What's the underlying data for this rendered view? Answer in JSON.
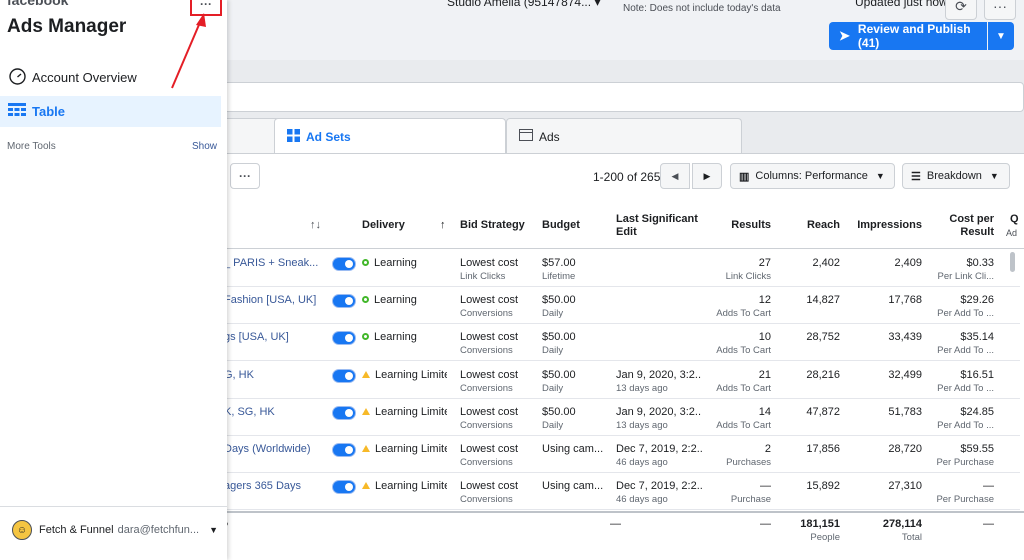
{
  "topbar": {
    "account_label": "Studio Amelia (95147874...",
    "date_note_top": "...",
    "date_note": "Note: Does not include today's data",
    "updated": "Updated just now",
    "refresh_icon": "refresh-icon",
    "more_icon": "more-icon",
    "review_publish": "Review and Publish (41)"
  },
  "tabs": {
    "adsets": "Ad Sets",
    "ads": "Ads"
  },
  "toolbar": {
    "more": "···",
    "pager": "1-200 of 265",
    "columns": "Columns: Performance",
    "breakdown": "Breakdown"
  },
  "table": {
    "headers": {
      "sort": "↑↓",
      "delivery": "Delivery",
      "delivery_arrow": "↑",
      "bid_strategy": "Bid Strategy",
      "budget": "Budget",
      "last_edit": "Last Significant Edit",
      "results": "Results",
      "reach": "Reach",
      "impressions": "Impressions",
      "cost_per_result": "Cost per Result",
      "q": "Q",
      "q_sub": "Ad"
    },
    "rows": [
      {
        "name": "_ PARIS + Sneak...",
        "delivery": "Learning",
        "status": "green",
        "bid": "Lowest cost",
        "bid_sub": "Link Clicks",
        "budget": "$57.00",
        "budget_sub": "Lifetime",
        "edit": "",
        "edit_sub": "",
        "results": "27",
        "results_sub": "Link Clicks",
        "reach": "2,402",
        "impressions": "2,409",
        "cpr": "$0.33",
        "cpr_sub": "Per Link Cli..."
      },
      {
        "name": "Fashion [USA, UK]",
        "delivery": "Learning",
        "status": "green",
        "bid": "Lowest cost",
        "bid_sub": "Conversions",
        "budget": "$50.00",
        "budget_sub": "Daily",
        "edit": "",
        "edit_sub": "",
        "results": "12",
        "results_sub": "Adds To Cart",
        "reach": "14,827",
        "impressions": "17,768",
        "cpr": "$29.26",
        "cpr_sub": "Per Add To ..."
      },
      {
        "name": "gs [USA, UK]",
        "delivery": "Learning",
        "status": "green",
        "bid": "Lowest cost",
        "bid_sub": "Conversions",
        "budget": "$50.00",
        "budget_sub": "Daily",
        "edit": "",
        "edit_sub": "",
        "results": "10",
        "results_sub": "Adds To Cart",
        "reach": "28,752",
        "impressions": "33,439",
        "cpr": "$35.14",
        "cpr_sub": "Per Add To ..."
      },
      {
        "name": "G, HK",
        "delivery": "Learning Limite",
        "status": "yellow",
        "bid": "Lowest cost",
        "bid_sub": "Conversions",
        "budget": "$50.00",
        "budget_sub": "Daily",
        "edit": "Jan 9, 2020, 3:2...",
        "edit_sub": "13 days ago",
        "results": "21",
        "results_sub": "Adds To Cart",
        "reach": "28,216",
        "impressions": "32,499",
        "cpr": "$16.51",
        "cpr_sub": "Per Add To ..."
      },
      {
        "name": "K, SG, HK",
        "delivery": "Learning Limite",
        "status": "yellow",
        "bid": "Lowest cost",
        "bid_sub": "Conversions",
        "budget": "$50.00",
        "budget_sub": "Daily",
        "edit": "Jan 9, 2020, 3:2...",
        "edit_sub": "13 days ago",
        "results": "14",
        "results_sub": "Adds To Cart",
        "reach": "47,872",
        "impressions": "51,783",
        "cpr": "$24.85",
        "cpr_sub": "Per Add To ..."
      },
      {
        "name": "Days (Worldwide)",
        "delivery": "Learning Limite",
        "status": "yellow",
        "bid": "Lowest cost",
        "bid_sub": "Conversions",
        "budget": "Using cam...",
        "budget_sub": "",
        "edit": "Dec 7, 2019, 2:2...",
        "edit_sub": "46 days ago",
        "results": "2",
        "results_sub": "Purchases",
        "reach": "17,856",
        "impressions": "28,720",
        "cpr": "$59.55",
        "cpr_sub": "Per Purchase"
      },
      {
        "name": "agers 365 Days",
        "delivery": "Learning Limite",
        "status": "yellow",
        "bid": "Lowest cost",
        "bid_sub": "Conversions",
        "budget": "Using cam...",
        "budget_sub": "",
        "edit": "Dec 7, 2019, 2:2...",
        "edit_sub": "46 days ago",
        "results": "—",
        "results_sub": "Purchase",
        "reach": "15,892",
        "impressions": "27,310",
        "cpr": "—",
        "cpr_sub": "Per Purchase"
      }
    ],
    "totals": {
      "edit": "—",
      "results": "—",
      "reach": "181,151",
      "reach_sub": "People",
      "impressions": "278,114",
      "impressions_sub": "Total",
      "cpr": "—"
    }
  },
  "sidebar": {
    "logo": "facebook",
    "title": "Ads Manager",
    "more": "···",
    "items": [
      {
        "label": "Account Overview",
        "icon": "gauge-icon"
      },
      {
        "label": "Table",
        "icon": "table-icon"
      }
    ],
    "more_tools": "More Tools",
    "show": "Show",
    "account_name": "Fetch & Funnel",
    "account_email": "dara@fetchfun..."
  },
  "colors": {
    "accent": "#1877f2",
    "annotation": "#e41e26",
    "learning": "#42b72a",
    "limited": "#f7b928"
  }
}
